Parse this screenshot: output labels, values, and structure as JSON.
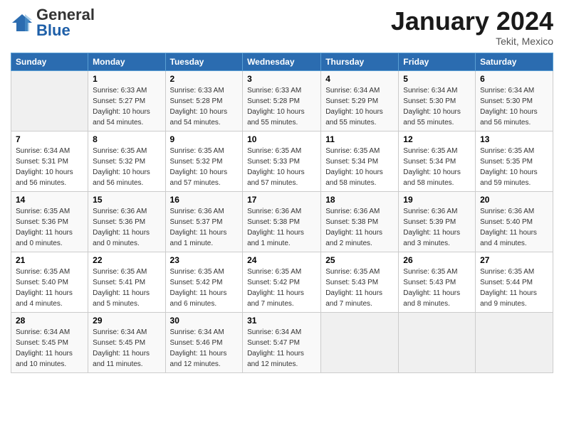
{
  "logo": {
    "general": "General",
    "blue": "Blue"
  },
  "header": {
    "month": "January 2024",
    "location": "Tekit, Mexico"
  },
  "days_of_week": [
    "Sunday",
    "Monday",
    "Tuesday",
    "Wednesday",
    "Thursday",
    "Friday",
    "Saturday"
  ],
  "weeks": [
    [
      {
        "day": "",
        "sunrise": "",
        "sunset": "",
        "daylight": ""
      },
      {
        "day": "1",
        "sunrise": "Sunrise: 6:33 AM",
        "sunset": "Sunset: 5:27 PM",
        "daylight": "Daylight: 10 hours and 54 minutes."
      },
      {
        "day": "2",
        "sunrise": "Sunrise: 6:33 AM",
        "sunset": "Sunset: 5:28 PM",
        "daylight": "Daylight: 10 hours and 54 minutes."
      },
      {
        "day": "3",
        "sunrise": "Sunrise: 6:33 AM",
        "sunset": "Sunset: 5:28 PM",
        "daylight": "Daylight: 10 hours and 55 minutes."
      },
      {
        "day": "4",
        "sunrise": "Sunrise: 6:34 AM",
        "sunset": "Sunset: 5:29 PM",
        "daylight": "Daylight: 10 hours and 55 minutes."
      },
      {
        "day": "5",
        "sunrise": "Sunrise: 6:34 AM",
        "sunset": "Sunset: 5:30 PM",
        "daylight": "Daylight: 10 hours and 55 minutes."
      },
      {
        "day": "6",
        "sunrise": "Sunrise: 6:34 AM",
        "sunset": "Sunset: 5:30 PM",
        "daylight": "Daylight: 10 hours and 56 minutes."
      }
    ],
    [
      {
        "day": "7",
        "sunrise": "Sunrise: 6:34 AM",
        "sunset": "Sunset: 5:31 PM",
        "daylight": "Daylight: 10 hours and 56 minutes."
      },
      {
        "day": "8",
        "sunrise": "Sunrise: 6:35 AM",
        "sunset": "Sunset: 5:32 PM",
        "daylight": "Daylight: 10 hours and 56 minutes."
      },
      {
        "day": "9",
        "sunrise": "Sunrise: 6:35 AM",
        "sunset": "Sunset: 5:32 PM",
        "daylight": "Daylight: 10 hours and 57 minutes."
      },
      {
        "day": "10",
        "sunrise": "Sunrise: 6:35 AM",
        "sunset": "Sunset: 5:33 PM",
        "daylight": "Daylight: 10 hours and 57 minutes."
      },
      {
        "day": "11",
        "sunrise": "Sunrise: 6:35 AM",
        "sunset": "Sunset: 5:34 PM",
        "daylight": "Daylight: 10 hours and 58 minutes."
      },
      {
        "day": "12",
        "sunrise": "Sunrise: 6:35 AM",
        "sunset": "Sunset: 5:34 PM",
        "daylight": "Daylight: 10 hours and 58 minutes."
      },
      {
        "day": "13",
        "sunrise": "Sunrise: 6:35 AM",
        "sunset": "Sunset: 5:35 PM",
        "daylight": "Daylight: 10 hours and 59 minutes."
      }
    ],
    [
      {
        "day": "14",
        "sunrise": "Sunrise: 6:35 AM",
        "sunset": "Sunset: 5:36 PM",
        "daylight": "Daylight: 11 hours and 0 minutes."
      },
      {
        "day": "15",
        "sunrise": "Sunrise: 6:36 AM",
        "sunset": "Sunset: 5:36 PM",
        "daylight": "Daylight: 11 hours and 0 minutes."
      },
      {
        "day": "16",
        "sunrise": "Sunrise: 6:36 AM",
        "sunset": "Sunset: 5:37 PM",
        "daylight": "Daylight: 11 hours and 1 minute."
      },
      {
        "day": "17",
        "sunrise": "Sunrise: 6:36 AM",
        "sunset": "Sunset: 5:38 PM",
        "daylight": "Daylight: 11 hours and 1 minute."
      },
      {
        "day": "18",
        "sunrise": "Sunrise: 6:36 AM",
        "sunset": "Sunset: 5:38 PM",
        "daylight": "Daylight: 11 hours and 2 minutes."
      },
      {
        "day": "19",
        "sunrise": "Sunrise: 6:36 AM",
        "sunset": "Sunset: 5:39 PM",
        "daylight": "Daylight: 11 hours and 3 minutes."
      },
      {
        "day": "20",
        "sunrise": "Sunrise: 6:36 AM",
        "sunset": "Sunset: 5:40 PM",
        "daylight": "Daylight: 11 hours and 4 minutes."
      }
    ],
    [
      {
        "day": "21",
        "sunrise": "Sunrise: 6:35 AM",
        "sunset": "Sunset: 5:40 PM",
        "daylight": "Daylight: 11 hours and 4 minutes."
      },
      {
        "day": "22",
        "sunrise": "Sunrise: 6:35 AM",
        "sunset": "Sunset: 5:41 PM",
        "daylight": "Daylight: 11 hours and 5 minutes."
      },
      {
        "day": "23",
        "sunrise": "Sunrise: 6:35 AM",
        "sunset": "Sunset: 5:42 PM",
        "daylight": "Daylight: 11 hours and 6 minutes."
      },
      {
        "day": "24",
        "sunrise": "Sunrise: 6:35 AM",
        "sunset": "Sunset: 5:42 PM",
        "daylight": "Daylight: 11 hours and 7 minutes."
      },
      {
        "day": "25",
        "sunrise": "Sunrise: 6:35 AM",
        "sunset": "Sunset: 5:43 PM",
        "daylight": "Daylight: 11 hours and 7 minutes."
      },
      {
        "day": "26",
        "sunrise": "Sunrise: 6:35 AM",
        "sunset": "Sunset: 5:43 PM",
        "daylight": "Daylight: 11 hours and 8 minutes."
      },
      {
        "day": "27",
        "sunrise": "Sunrise: 6:35 AM",
        "sunset": "Sunset: 5:44 PM",
        "daylight": "Daylight: 11 hours and 9 minutes."
      }
    ],
    [
      {
        "day": "28",
        "sunrise": "Sunrise: 6:34 AM",
        "sunset": "Sunset: 5:45 PM",
        "daylight": "Daylight: 11 hours and 10 minutes."
      },
      {
        "day": "29",
        "sunrise": "Sunrise: 6:34 AM",
        "sunset": "Sunset: 5:45 PM",
        "daylight": "Daylight: 11 hours and 11 minutes."
      },
      {
        "day": "30",
        "sunrise": "Sunrise: 6:34 AM",
        "sunset": "Sunset: 5:46 PM",
        "daylight": "Daylight: 11 hours and 12 minutes."
      },
      {
        "day": "31",
        "sunrise": "Sunrise: 6:34 AM",
        "sunset": "Sunset: 5:47 PM",
        "daylight": "Daylight: 11 hours and 12 minutes."
      },
      {
        "day": "",
        "sunrise": "",
        "sunset": "",
        "daylight": ""
      },
      {
        "day": "",
        "sunrise": "",
        "sunset": "",
        "daylight": ""
      },
      {
        "day": "",
        "sunrise": "",
        "sunset": "",
        "daylight": ""
      }
    ]
  ]
}
